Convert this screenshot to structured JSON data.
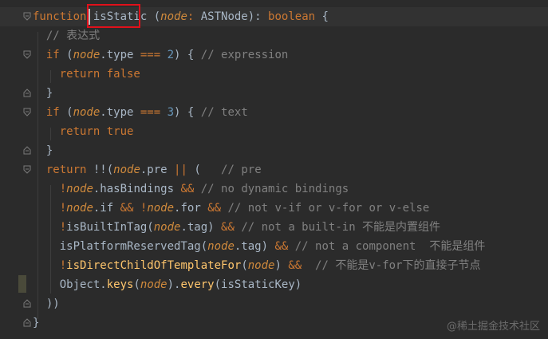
{
  "code": {
    "lines": [
      [
        {
          "t": "function ",
          "c": "kw"
        },
        {
          "t": "isStatic",
          "c": "fnwhite"
        },
        {
          "t": " (",
          "c": "plain"
        },
        {
          "t": "node",
          "c": "param"
        },
        {
          "t": ": ",
          "c": "kw"
        },
        {
          "t": "ASTNode",
          "c": "plain"
        },
        {
          "t": "): ",
          "c": "plain"
        },
        {
          "t": "boolean",
          "c": "kw"
        },
        {
          "t": " {",
          "c": "plain"
        }
      ],
      [
        {
          "t": "  // 表达式",
          "c": "cmt"
        }
      ],
      [
        {
          "t": "  ",
          "c": "plain"
        },
        {
          "t": "if",
          "c": "kw"
        },
        {
          "t": " (",
          "c": "plain"
        },
        {
          "t": "node",
          "c": "param"
        },
        {
          "t": ".type ",
          "c": "plain"
        },
        {
          "t": "===",
          "c": "op"
        },
        {
          "t": " ",
          "c": "plain"
        },
        {
          "t": "2",
          "c": "num"
        },
        {
          "t": ") { ",
          "c": "plain"
        },
        {
          "t": "// expression",
          "c": "cmt"
        }
      ],
      [
        {
          "t": "    ",
          "c": "plain"
        },
        {
          "t": "return false",
          "c": "kw"
        }
      ],
      [
        {
          "t": "  }",
          "c": "plain"
        }
      ],
      [
        {
          "t": "  ",
          "c": "plain"
        },
        {
          "t": "if",
          "c": "kw"
        },
        {
          "t": " (",
          "c": "plain"
        },
        {
          "t": "node",
          "c": "param"
        },
        {
          "t": ".type ",
          "c": "plain"
        },
        {
          "t": "===",
          "c": "op"
        },
        {
          "t": " ",
          "c": "plain"
        },
        {
          "t": "3",
          "c": "num"
        },
        {
          "t": ") { ",
          "c": "plain"
        },
        {
          "t": "// text",
          "c": "cmt"
        }
      ],
      [
        {
          "t": "    ",
          "c": "plain"
        },
        {
          "t": "return true",
          "c": "kw"
        }
      ],
      [
        {
          "t": "  }",
          "c": "plain"
        }
      ],
      [
        {
          "t": "  ",
          "c": "plain"
        },
        {
          "t": "return",
          "c": "kw"
        },
        {
          "t": " !!(",
          "c": "plain"
        },
        {
          "t": "node",
          "c": "param"
        },
        {
          "t": ".pre ",
          "c": "plain"
        },
        {
          "t": "||",
          "c": "op"
        },
        {
          "t": " (   ",
          "c": "plain"
        },
        {
          "t": "// pre",
          "c": "cmt"
        }
      ],
      [
        {
          "t": "    ",
          "c": "plain"
        },
        {
          "t": "!",
          "c": "op"
        },
        {
          "t": "node",
          "c": "param"
        },
        {
          "t": ".hasBindings ",
          "c": "plain"
        },
        {
          "t": "&&",
          "c": "op"
        },
        {
          "t": " ",
          "c": "plain"
        },
        {
          "t": "// no dynamic bindings",
          "c": "cmt"
        }
      ],
      [
        {
          "t": "    ",
          "c": "plain"
        },
        {
          "t": "!",
          "c": "op"
        },
        {
          "t": "node",
          "c": "param"
        },
        {
          "t": ".if ",
          "c": "plain"
        },
        {
          "t": "&&",
          "c": "op"
        },
        {
          "t": " ",
          "c": "plain"
        },
        {
          "t": "!",
          "c": "op"
        },
        {
          "t": "node",
          "c": "param"
        },
        {
          "t": ".for ",
          "c": "plain"
        },
        {
          "t": "&&",
          "c": "op"
        },
        {
          "t": " ",
          "c": "plain"
        },
        {
          "t": "// not v-if or v-for or v-else",
          "c": "cmt"
        }
      ],
      [
        {
          "t": "    ",
          "c": "plain"
        },
        {
          "t": "!",
          "c": "op"
        },
        {
          "t": "isBuiltInTag(",
          "c": "plain"
        },
        {
          "t": "node",
          "c": "param"
        },
        {
          "t": ".tag) ",
          "c": "plain"
        },
        {
          "t": "&&",
          "c": "op"
        },
        {
          "t": " ",
          "c": "plain"
        },
        {
          "t": "// not a built-in 不能是内置组件",
          "c": "cmt"
        }
      ],
      [
        {
          "t": "    ",
          "c": "plain"
        },
        {
          "t": "isPlatformReservedTag(",
          "c": "plain"
        },
        {
          "t": "node",
          "c": "param"
        },
        {
          "t": ".tag) ",
          "c": "plain"
        },
        {
          "t": "&&",
          "c": "op"
        },
        {
          "t": " ",
          "c": "plain"
        },
        {
          "t": "// not a component  不能是组件",
          "c": "cmt"
        }
      ],
      [
        {
          "t": "    ",
          "c": "plain"
        },
        {
          "t": "!",
          "c": "op"
        },
        {
          "t": "isDirectChildOfTemplateFor",
          "c": "fn"
        },
        {
          "t": "(",
          "c": "plain"
        },
        {
          "t": "node",
          "c": "param"
        },
        {
          "t": ") ",
          "c": "plain"
        },
        {
          "t": "&&",
          "c": "op"
        },
        {
          "t": "  ",
          "c": "plain"
        },
        {
          "t": "// 不能是v-for下的直接子节点",
          "c": "cmt"
        }
      ],
      [
        {
          "t": "    ",
          "c": "plain"
        },
        {
          "t": "Object.",
          "c": "plain"
        },
        {
          "t": "keys",
          "c": "fn"
        },
        {
          "t": "(",
          "c": "plain"
        },
        {
          "t": "node",
          "c": "param"
        },
        {
          "t": ").",
          "c": "plain"
        },
        {
          "t": "every",
          "c": "fn"
        },
        {
          "t": "(isStaticKey)",
          "c": "plain"
        }
      ],
      [
        {
          "t": "  ))",
          "c": "plain"
        }
      ],
      [
        {
          "t": "}",
          "c": "plain"
        }
      ]
    ]
  },
  "watermark": "@稀土掘金技术社区"
}
